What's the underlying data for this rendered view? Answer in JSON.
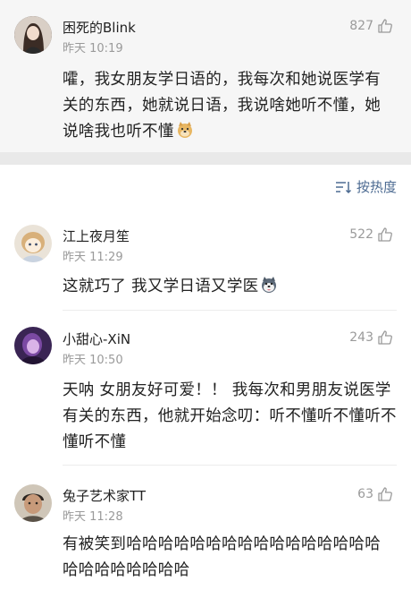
{
  "main": {
    "user": "困死的Blink",
    "time": "昨天 10:19",
    "likes": "827",
    "text": "嚯，我女朋友学日语的，我每次和她说医学有关的东西，她就说日语，我说啥她听不懂，她说啥我也听不懂"
  },
  "sort": {
    "label": "按热度",
    "icon": "sort-icon"
  },
  "replies": [
    {
      "user": "江上夜月笙",
      "time": "昨天 11:29",
      "likes": "522",
      "text": "这就巧了 我又学日语又学医"
    },
    {
      "user": "小甜心-XiN",
      "time": "昨天 10:50",
      "likes": "243",
      "text": "天呐 女朋友好可爱！！ 我每次和男朋友说医学有关的东西，他就开始念叨：听不懂听不懂听不懂听不懂"
    },
    {
      "user": "兔子艺术家TT",
      "time": "昨天 11:28",
      "likes": "63",
      "text": "有被笑到哈哈哈哈哈哈哈哈哈哈哈哈哈哈哈哈哈哈哈哈哈哈哈哈"
    }
  ],
  "colors": {
    "accent": "#4d6b92",
    "meta": "#9a9a9a",
    "main_bg": "#f6f6f6"
  }
}
